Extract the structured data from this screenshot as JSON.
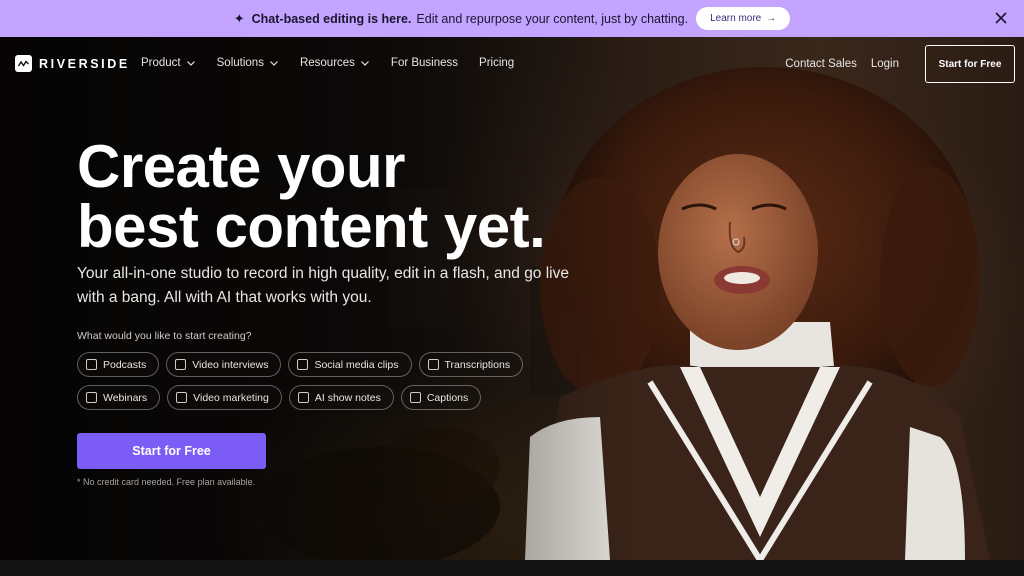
{
  "announcement": {
    "bold": "Chat-based editing is here.",
    "text": "Edit and repurpose your content, just by chatting.",
    "learn_more": "Learn more"
  },
  "nav": {
    "logo": "RIVERSIDE",
    "items": [
      "Product",
      "Solutions",
      "Resources",
      "For Business",
      "Pricing"
    ],
    "contact": "Contact Sales",
    "login": "Login",
    "cta": "Start for Free"
  },
  "hero": {
    "title_line1": "Create your",
    "title_line2": "best content yet.",
    "subtitle": "Your all-in-one studio to record in high quality, edit in a flash, and go live with a bang. All with AI that works with you.",
    "question": "What would you like to start creating?",
    "options_row1": [
      "Podcasts",
      "Video interviews",
      "Social media clips",
      "Transcriptions"
    ],
    "options_row2": [
      "Webinars",
      "Video marketing",
      "AI show notes",
      "Captions"
    ],
    "cta": "Start for Free",
    "note": "* No credit card needed. Free plan available."
  },
  "colors": {
    "announcement_bg": "#c3a5ff",
    "accent": "#7b5cf5"
  }
}
